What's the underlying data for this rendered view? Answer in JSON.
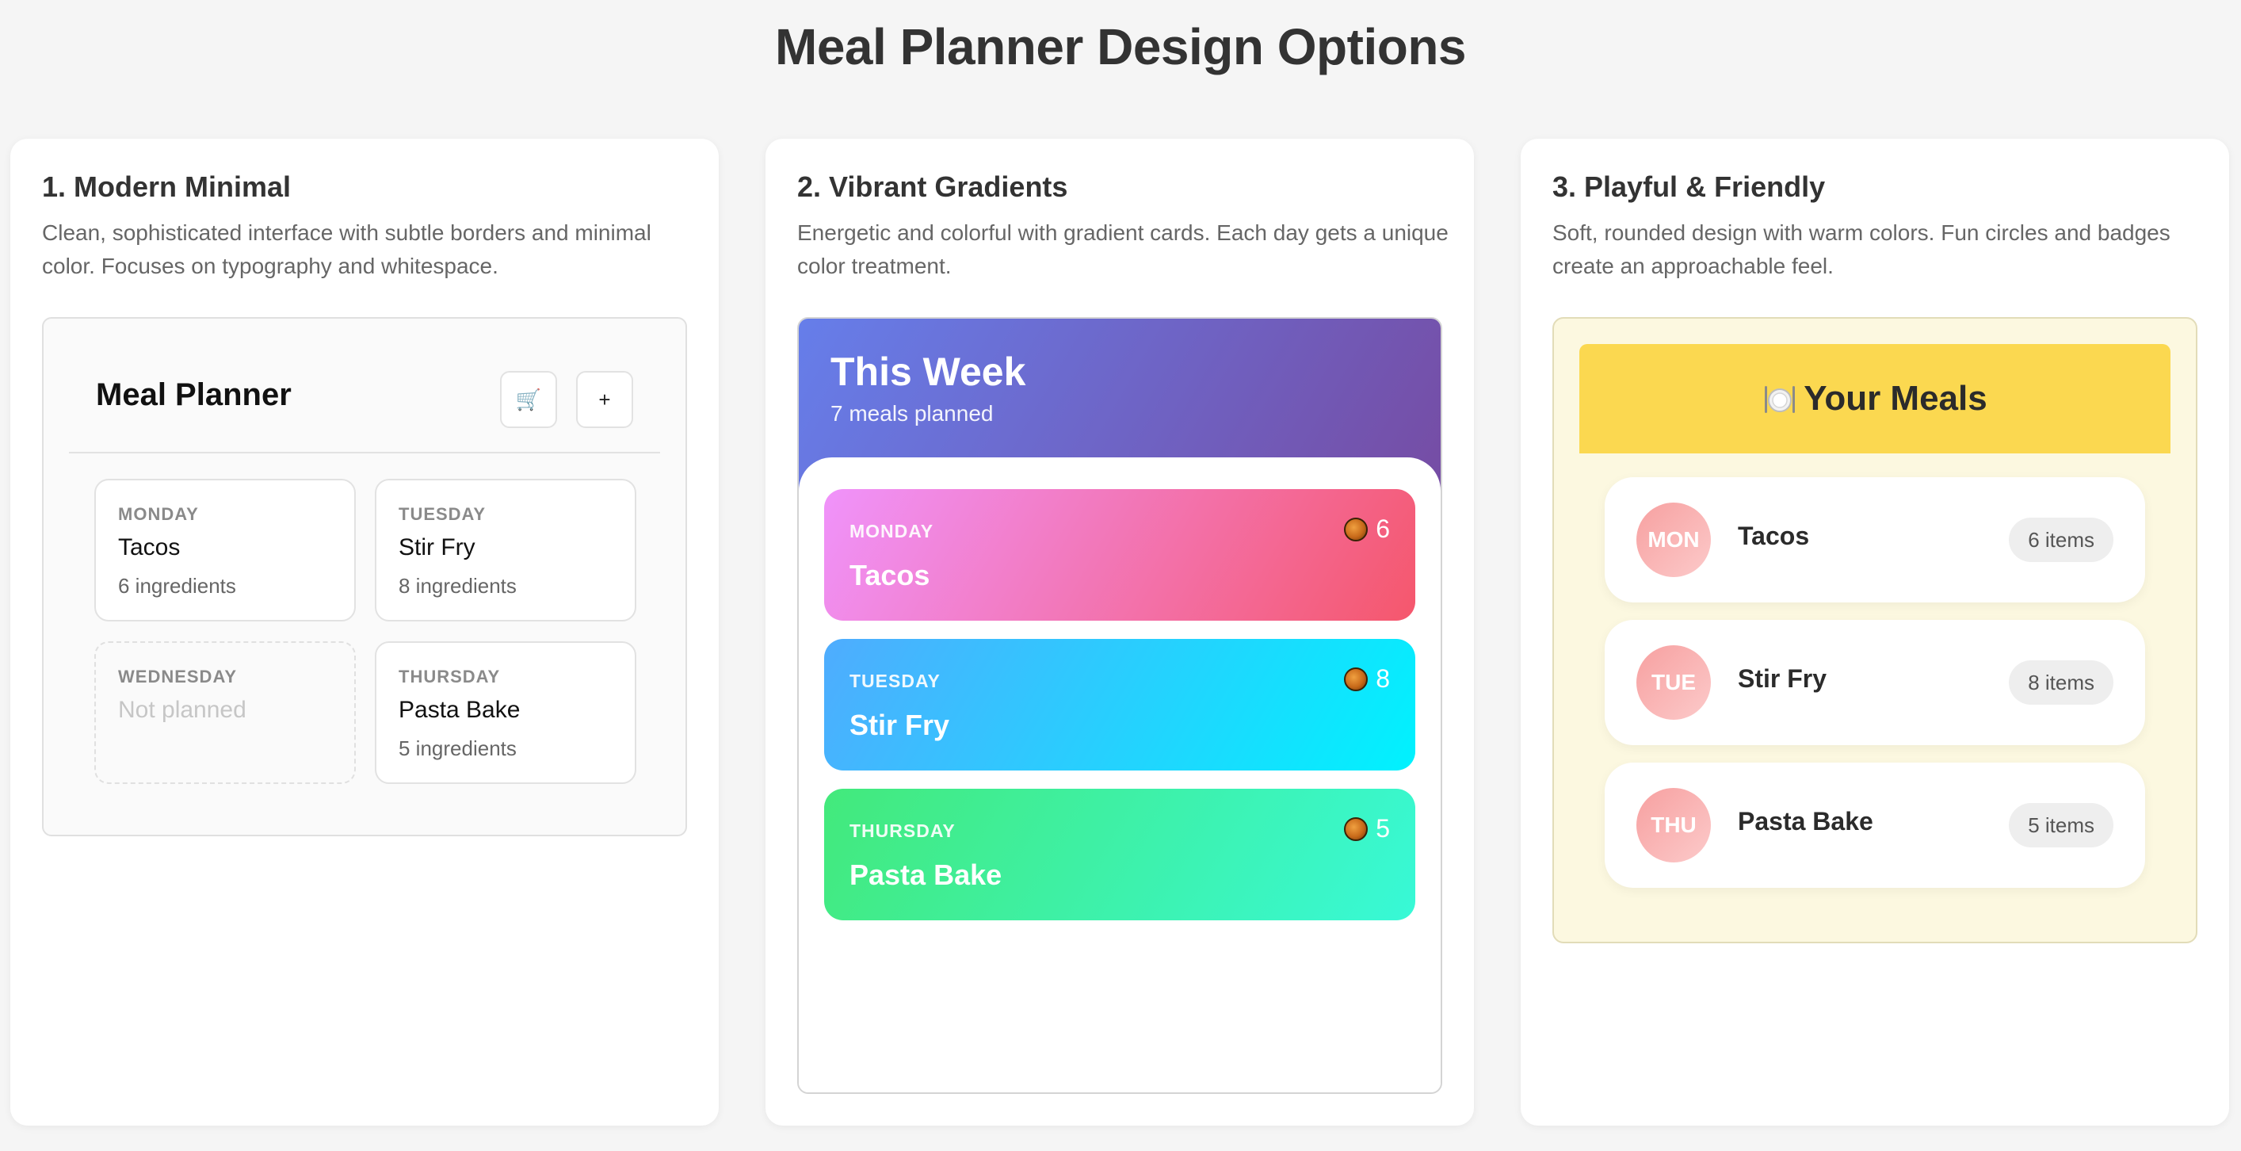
{
  "page": {
    "title": "Meal Planner Design Options"
  },
  "options": [
    {
      "title": "1. Modern Minimal",
      "description": "Clean, sophisticated interface with subtle borders and minimal color. Focuses on typography and whitespace."
    },
    {
      "title": "2. Vibrant Gradients",
      "description": "Energetic and colorful with gradient cards. Each day gets a unique color treatment."
    },
    {
      "title": "3. Playful & Friendly",
      "description": "Soft, rounded design with warm colors. Fun circles and badges create an approachable feel."
    }
  ],
  "minimal": {
    "title": "Meal Planner",
    "cart_icon": "🛒",
    "add_label": "+",
    "days": [
      {
        "name": "MONDAY",
        "meal": "Tacos",
        "count": "6 ingredients"
      },
      {
        "name": "TUESDAY",
        "meal": "Stir Fry",
        "count": "8 ingredients"
      },
      {
        "name": "WEDNESDAY",
        "meal": "Not planned",
        "count": ""
      },
      {
        "name": "THURSDAY",
        "meal": "Pasta Bake",
        "count": "5 ingredients"
      }
    ]
  },
  "vibrant": {
    "title": "This Week",
    "subtitle": "7 meals planned",
    "days": [
      {
        "name": "MONDAY",
        "meal": "Tacos",
        "count": "6",
        "gradient": [
          "#f093fb",
          "#f5576c"
        ]
      },
      {
        "name": "TUESDAY",
        "meal": "Stir Fry",
        "count": "8",
        "gradient": [
          "#4facfe",
          "#00f2fe"
        ]
      },
      {
        "name": "THURSDAY",
        "meal": "Pasta Bake",
        "count": "5",
        "gradient": [
          "#43e97b",
          "#38f9d7"
        ]
      }
    ]
  },
  "playful": {
    "title": "Your Meals",
    "items": [
      {
        "day": "MON",
        "meal": "Tacos",
        "count": "6 items"
      },
      {
        "day": "TUE",
        "meal": "Stir Fry",
        "count": "8 items"
      },
      {
        "day": "THU",
        "meal": "Pasta Bake",
        "count": "5 items"
      }
    ]
  }
}
